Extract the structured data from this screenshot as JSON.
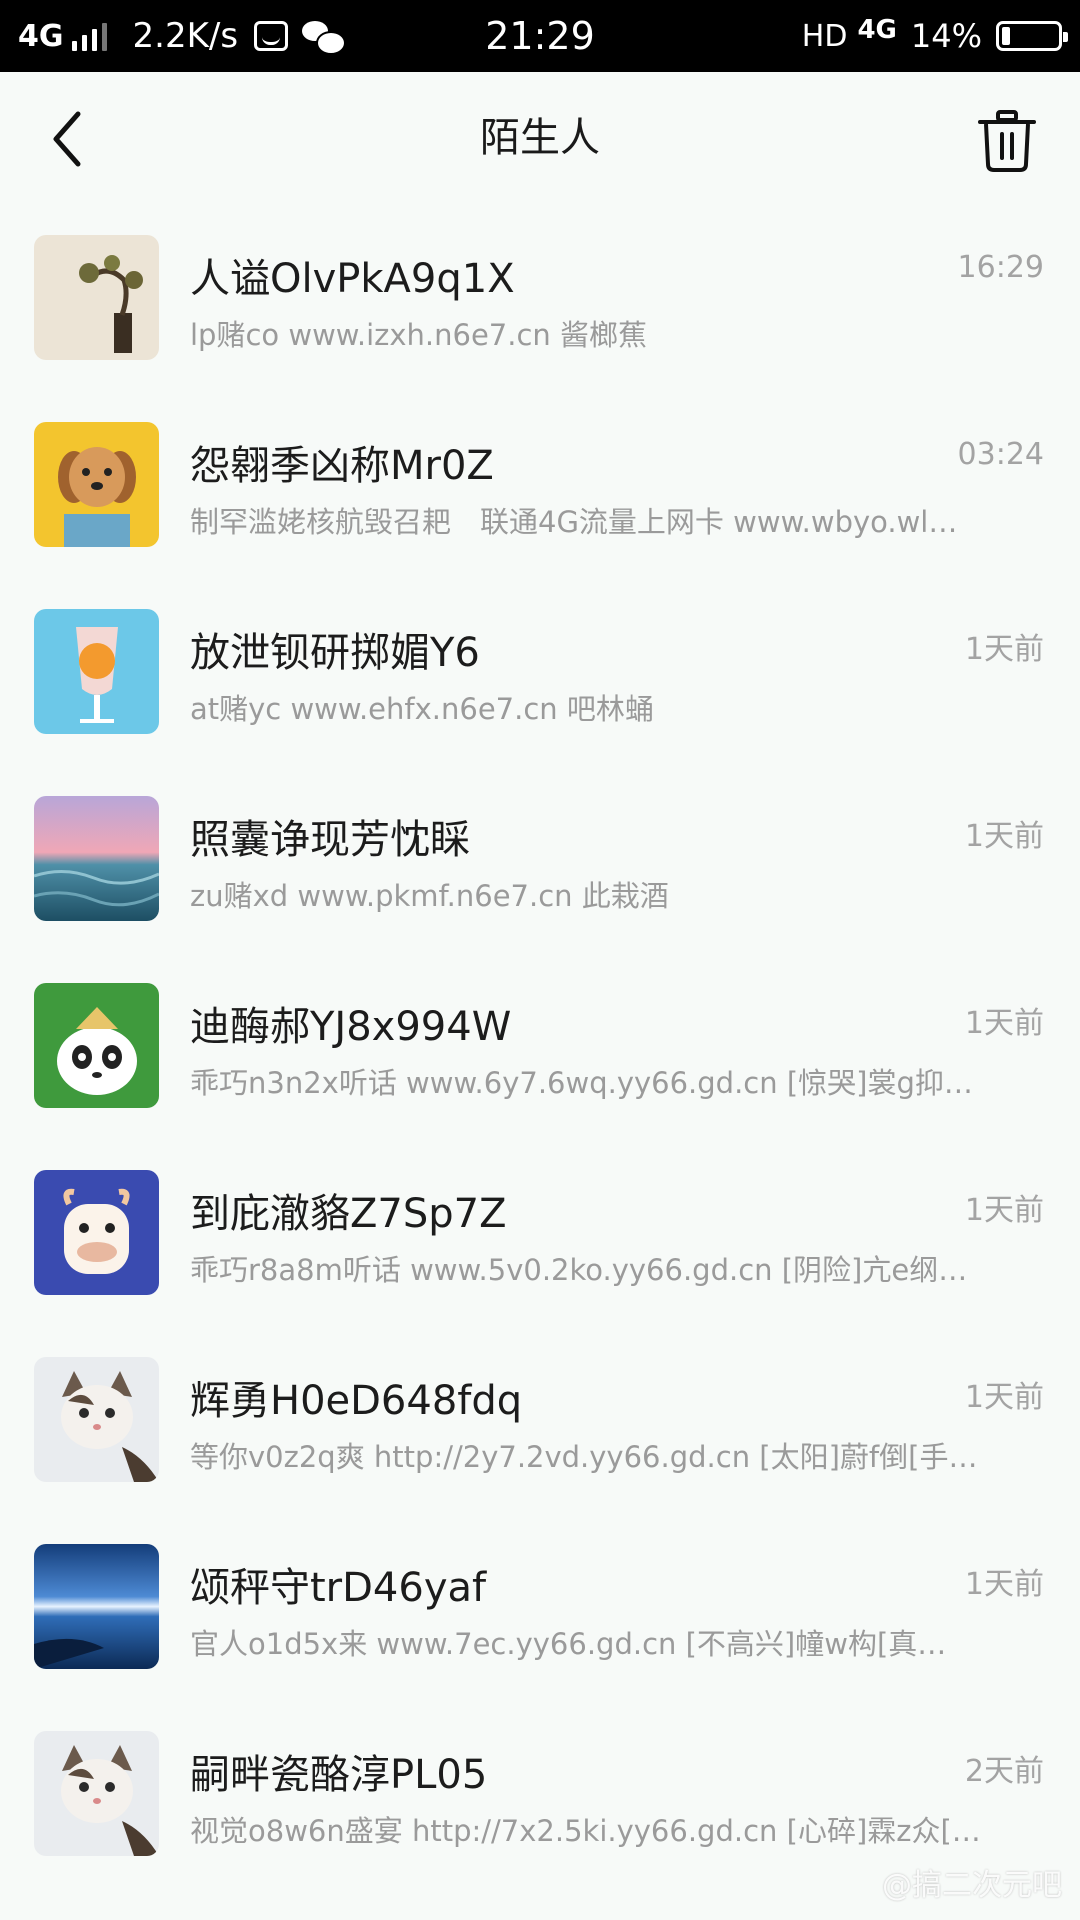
{
  "status_bar": {
    "network": "4G",
    "speed": "2.2K/s",
    "time": "21:29",
    "hd": "HD",
    "data_type": "4G",
    "battery_percent": "14%",
    "battery_level": 0.14
  },
  "header": {
    "title": "陌生人"
  },
  "conversations": [
    {
      "name": "人谥OlvPkA9q1X",
      "preview": "lp赌co www.izxh.n6e7.cn 酱榔蕉",
      "time": "16:29",
      "avatar": "bonsai-tree"
    },
    {
      "name": "怨翱季凶称Mr0Z",
      "preview": "制罕滥姥核航毁召耙　联通4G流量上网卡 www.wbyo.wl…",
      "time": "03:24",
      "avatar": "puppy"
    },
    {
      "name": "放泄钡研掷媚Y6",
      "preview": "at赌yc www.ehfx.n6e7.cn 吧林蛹",
      "time": "1天前",
      "avatar": "drink-glass"
    },
    {
      "name": "照囊诤现芳忱睬",
      "preview": "zu赌xd www.pkmf.n6e7.cn 此栽酒",
      "time": "1天前",
      "avatar": "ocean-sunset"
    },
    {
      "name": "迪酶郝YJ8x994W",
      "preview": "乖巧n3n2x听话 www.6y7.6wq.yy66.gd.cn  [惊哭]裳g抑…",
      "time": "1天前",
      "avatar": "panda"
    },
    {
      "name": "到庇澈貉Z7Sp7Z",
      "preview": "乖巧r8a8m听话 www.5v0.2ko.yy66.gd.cn  [阴险]亢e纲…",
      "time": "1天前",
      "avatar": "cow"
    },
    {
      "name": "辉勇H0eD648fdq",
      "preview": "等你v0z2q爽 http://2y7.2vd.yy66.gd.cn  [太阳]蔚f倒[手…",
      "time": "1天前",
      "avatar": "cat"
    },
    {
      "name": "颂秤守trD46yaf",
      "preview": "官人o1d5x来 www.7ec.yy66.gd.cn  [不高兴]幢w构[真…",
      "time": "1天前",
      "avatar": "night-lake"
    },
    {
      "name": "嗣畔瓷酪淳PL05",
      "preview": "视觉o8w6n盛宴 http://7x2.5ki.yy66.gd.cn  [心碎]霖z众[…",
      "time": "2天前",
      "avatar": "cat"
    }
  ],
  "watermark": "@搞二次元吧"
}
